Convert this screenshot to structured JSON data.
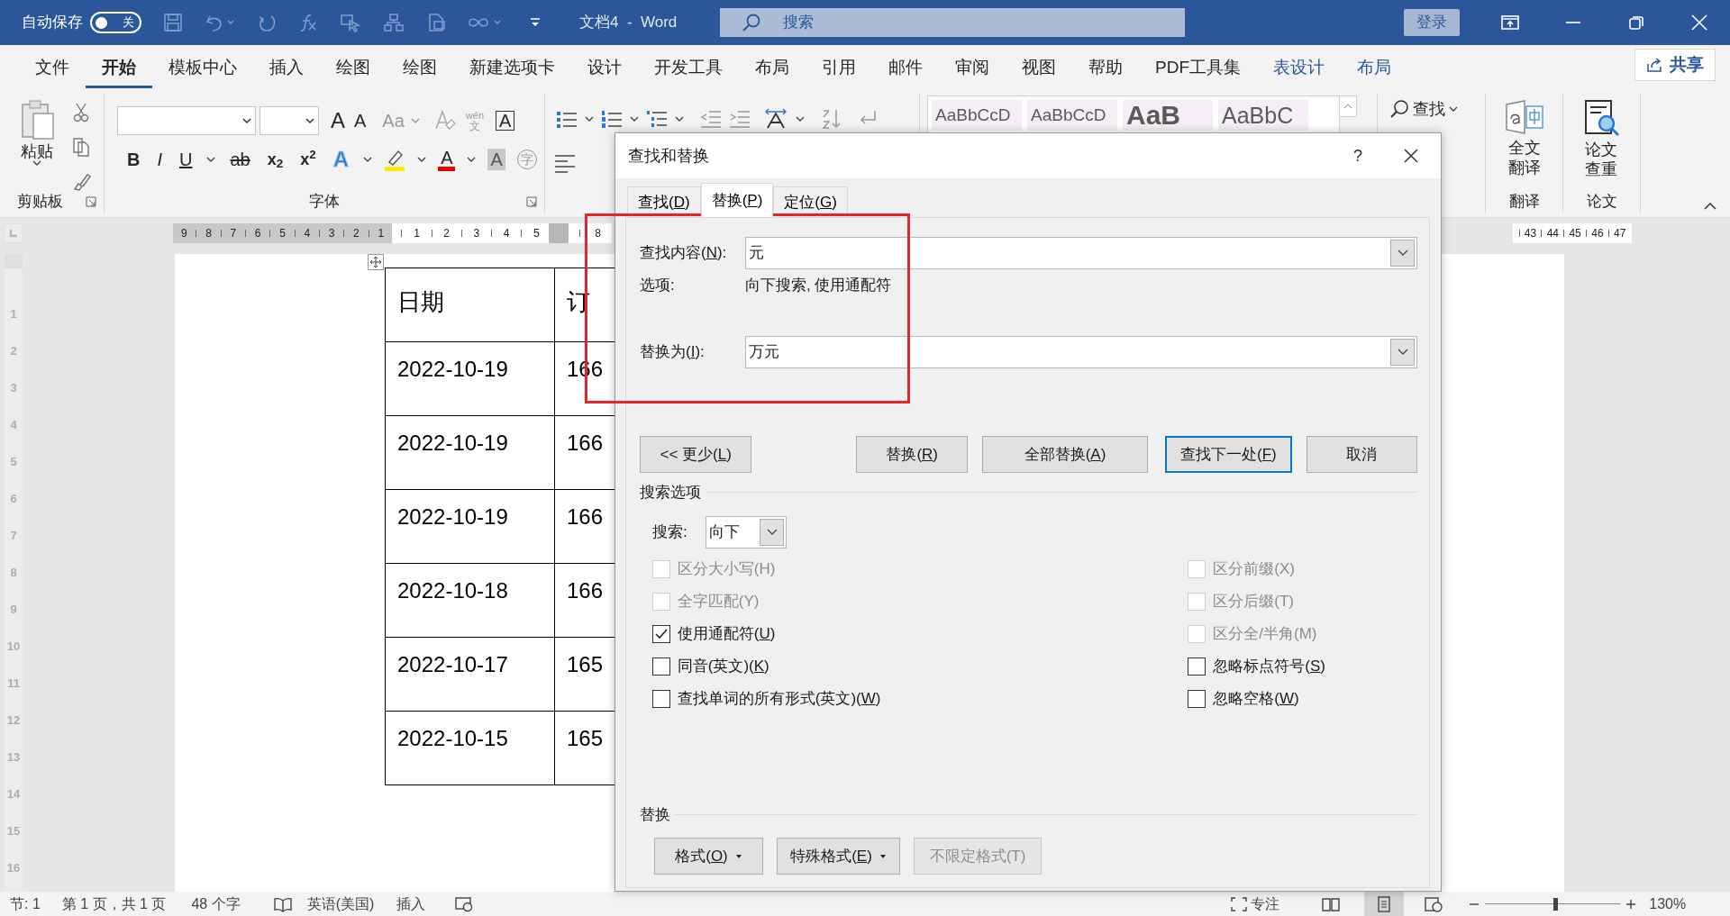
{
  "title_bar": {
    "autosave_label": "自动保存",
    "autosave": {
      "on": false,
      "label": "关"
    },
    "document_title": "文档4  -  Word",
    "search_placeholder": "搜索",
    "sign_in": "登录"
  },
  "ribbon_tabs": [
    {
      "label": "文件",
      "selected": false,
      "kind": "main"
    },
    {
      "label": "开始",
      "selected": true,
      "kind": "main"
    },
    {
      "label": "模板中心",
      "selected": false,
      "kind": "main"
    },
    {
      "label": "插入",
      "selected": false,
      "kind": "main"
    },
    {
      "label": "绘图",
      "selected": false,
      "kind": "main"
    },
    {
      "label": "绘图",
      "selected": false,
      "kind": "main"
    },
    {
      "label": "新建选项卡",
      "selected": false,
      "kind": "main"
    },
    {
      "label": "设计",
      "selected": false,
      "kind": "main"
    },
    {
      "label": "开发工具",
      "selected": false,
      "kind": "main"
    },
    {
      "label": "布局",
      "selected": false,
      "kind": "main"
    },
    {
      "label": "引用",
      "selected": false,
      "kind": "main"
    },
    {
      "label": "邮件",
      "selected": false,
      "kind": "main"
    },
    {
      "label": "审阅",
      "selected": false,
      "kind": "main"
    },
    {
      "label": "视图",
      "selected": false,
      "kind": "main"
    },
    {
      "label": "帮助",
      "selected": false,
      "kind": "main"
    },
    {
      "label": "PDF工具集",
      "selected": false,
      "kind": "main"
    },
    {
      "label": "表设计",
      "selected": false,
      "kind": "contextual"
    },
    {
      "label": "布局",
      "selected": false,
      "kind": "contextual"
    }
  ],
  "share_button": "共享",
  "ribbon": {
    "paste_label": "粘贴",
    "clipboard_group": "剪贴板",
    "grow_font": "A",
    "shrink_font": "A",
    "change_case": "Aa",
    "phonetic_guide": [
      "wén",
      "文"
    ],
    "char_border": "A",
    "format_buttons": [
      "B",
      "I",
      "U",
      "ab",
      "x$_{2}$",
      "x$^{2}$"
    ],
    "text_effect": "A",
    "font_color": "A",
    "char_shading": "A",
    "enclose_char": "字",
    "font_group": "字体",
    "styles": [
      "AaBbCcD",
      "AaBbCcD",
      "AaB",
      "AaBbC"
    ],
    "find": "查找",
    "translate": {
      "lines": [
        "全文",
        "翻译"
      ],
      "group": "翻译"
    },
    "paper_check": {
      "lines": [
        "论文",
        "查重"
      ],
      "group": "论文"
    }
  },
  "ruler": {
    "left_numbers": [
      "9",
      "8",
      "7",
      "6",
      "5",
      "4",
      "3",
      "2",
      "1"
    ],
    "right_numbers": [
      "1",
      "2",
      "3",
      "4",
      "5"
    ],
    "after_marker": [
      "8"
    ],
    "far_numbers": [
      "43",
      "44",
      "45",
      "46",
      "47"
    ],
    "vertical_numbers": [
      "1",
      "2",
      "3",
      "4",
      "5",
      "6",
      "7",
      "8",
      "9",
      "10",
      "11",
      "12",
      "13",
      "14",
      "15",
      "16"
    ]
  },
  "document_table": {
    "columns": [
      "日期",
      "订"
    ],
    "rows": [
      [
        "2022-10-19",
        "166"
      ],
      [
        "2022-10-19",
        "166"
      ],
      [
        "2022-10-19",
        "166"
      ],
      [
        "2022-10-18",
        "166"
      ],
      [
        "2022-10-17",
        "165"
      ],
      [
        "2022-10-15",
        "165"
      ]
    ]
  },
  "dialog": {
    "title": "查找和替换",
    "help": "?",
    "tabs": [
      {
        "label": "查找(D)",
        "selected": false
      },
      {
        "label": "替换(P)",
        "selected": true
      },
      {
        "label": "定位(G)",
        "selected": false
      }
    ],
    "find_what": {
      "label": "查找内容(N):",
      "value": "元"
    },
    "options": {
      "label": "选项:",
      "value": "向下搜索, 使用通配符"
    },
    "replace_with": {
      "label": "替换为(I):",
      "value": "万元"
    },
    "buttons": [
      {
        "label": "<< 更少(L)",
        "default": false
      },
      {
        "label": "替换(R)",
        "default": false
      },
      {
        "label": "全部替换(A)",
        "default": false
      },
      {
        "label": "查找下一处(F)",
        "default": true
      },
      {
        "label": "取消",
        "default": false
      }
    ],
    "search_options_title": "搜索选项",
    "search": {
      "label": "搜索:",
      "value": "向下"
    },
    "left_checks": [
      {
        "label": "区分大小写(H)",
        "checked": false,
        "disabled": true
      },
      {
        "label": "全字匹配(Y)",
        "checked": false,
        "disabled": true
      },
      {
        "label": "使用通配符(U)",
        "checked": true,
        "disabled": false
      },
      {
        "label": "同音(英文)(K)",
        "checked": false,
        "disabled": false
      },
      {
        "label": "查找单词的所有形式(英文)(W)",
        "checked": false,
        "disabled": false
      }
    ],
    "right_checks": [
      {
        "label": "区分前缀(X)",
        "checked": false,
        "disabled": true
      },
      {
        "label": "区分后缀(T)",
        "checked": false,
        "disabled": true
      },
      {
        "label": "区分全/半角(M)",
        "checked": false,
        "disabled": true
      },
      {
        "label": "忽略标点符号(S)",
        "checked": false,
        "disabled": false
      },
      {
        "label": "忽略空格(W)",
        "checked": false,
        "disabled": false
      }
    ],
    "replace_title": "替换",
    "format_buttons": [
      {
        "label": "格式(O)",
        "dropdown": true,
        "disabled": false
      },
      {
        "label": "特殊格式(E)",
        "dropdown": true,
        "disabled": false
      },
      {
        "label": "不限定格式(T)",
        "dropdown": false,
        "disabled": true
      }
    ]
  },
  "status_bar": {
    "section": "节: 1",
    "page": "第 1 页，共 1 页",
    "words": "48 个字",
    "language": "英语(美国)",
    "mode": "插入",
    "focus": "专注",
    "zoom_slider": {
      "level": 0.52
    },
    "zoom": "130%"
  }
}
